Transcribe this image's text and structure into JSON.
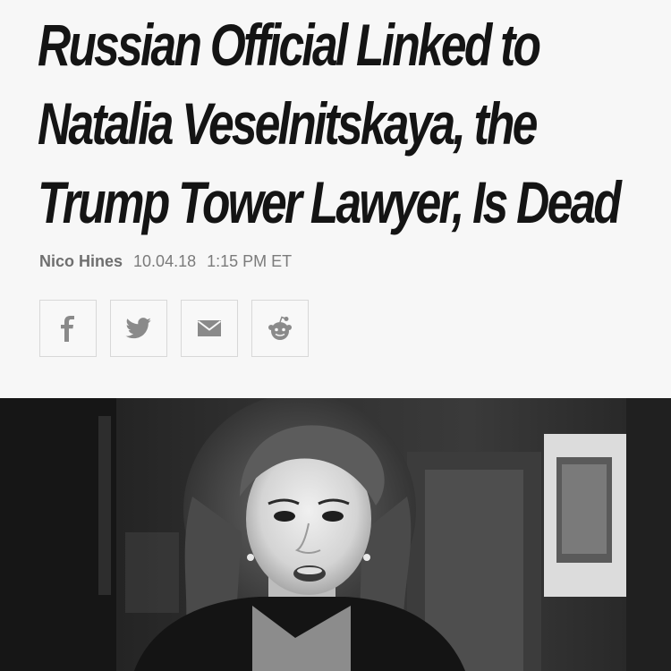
{
  "article": {
    "headline_lines": [
      "Russian Official Linked to",
      "Natalia Veselnitskaya, the",
      "Trump Tower Lawyer, Is Dead"
    ],
    "author": "Nico Hines",
    "date": "10.04.18",
    "time": "1:15 PM ET"
  },
  "share": {
    "buttons": [
      {
        "icon": "facebook-icon"
      },
      {
        "icon": "twitter-icon"
      },
      {
        "icon": "email-icon"
      },
      {
        "icon": "reddit-icon"
      }
    ],
    "icon_color": "#8a8a8a"
  },
  "photo": {
    "style": "black-and-white",
    "subject": "woman-portrait"
  }
}
